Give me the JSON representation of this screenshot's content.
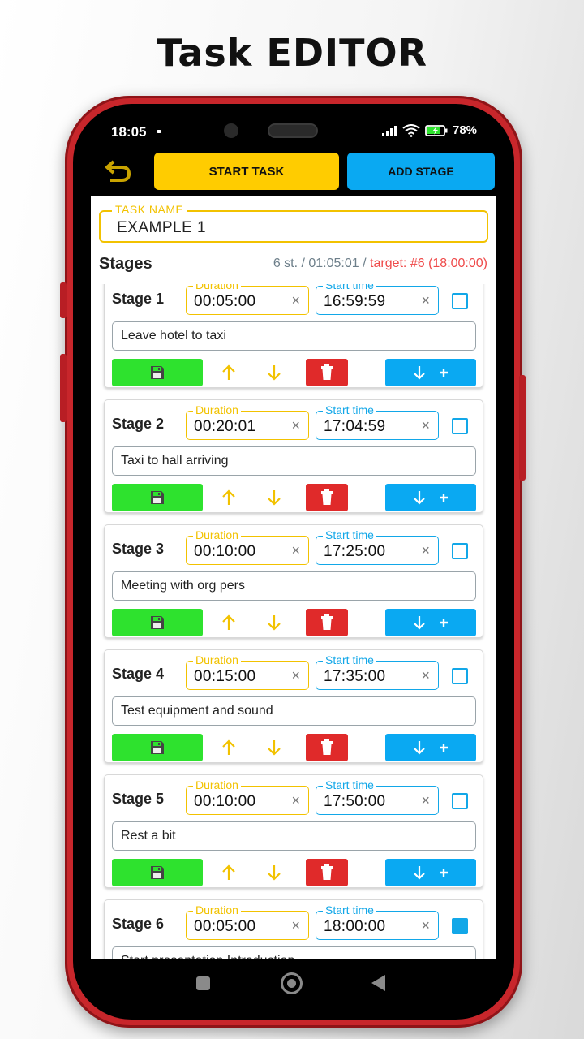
{
  "headline": "Task EDITOR",
  "status_bar": {
    "time": "18:05",
    "battery": "78%"
  },
  "toolbar": {
    "start_label": "START TASK",
    "add_label": "ADD STAGE"
  },
  "task": {
    "name_label": "TASK NAME",
    "name_value": "EXAMPLE 1"
  },
  "stages_header": {
    "title": "Stages",
    "summary": "6 st. / 01:05:01 /",
    "target": "target: #6 (18:00:00)"
  },
  "field_labels": {
    "duration": "Duration",
    "start_time": "Start time",
    "clear": "×"
  },
  "stages": [
    {
      "label": "Stage 1",
      "duration": "00:05:00",
      "start": "16:59:59",
      "description": "Leave hotel to taxi",
      "checked": false
    },
    {
      "label": "Stage 2",
      "duration": "00:20:01",
      "start": "17:04:59",
      "description": "Taxi to hall arriving",
      "checked": false
    },
    {
      "label": "Stage 3",
      "duration": "00:10:00",
      "start": "17:25:00",
      "description": "Meeting with org pers",
      "checked": false
    },
    {
      "label": "Stage 4",
      "duration": "00:15:00",
      "start": "17:35:00",
      "description": "Test equipment and sound",
      "checked": false
    },
    {
      "label": "Stage 5",
      "duration": "00:10:00",
      "start": "17:50:00",
      "description": "Rest a bit",
      "checked": false
    },
    {
      "label": "Stage 6",
      "duration": "00:05:00",
      "start": "18:00:00",
      "description": "Start presentation Introduction",
      "checked": true
    }
  ],
  "colors": {
    "accent_yellow": "#ffcc00",
    "accent_blue": "#0aa9f2",
    "save_green": "#2ee22e",
    "delete_red": "#e02a2a",
    "target_red": "#ef4a4a",
    "phone_red": "#c8262b"
  }
}
